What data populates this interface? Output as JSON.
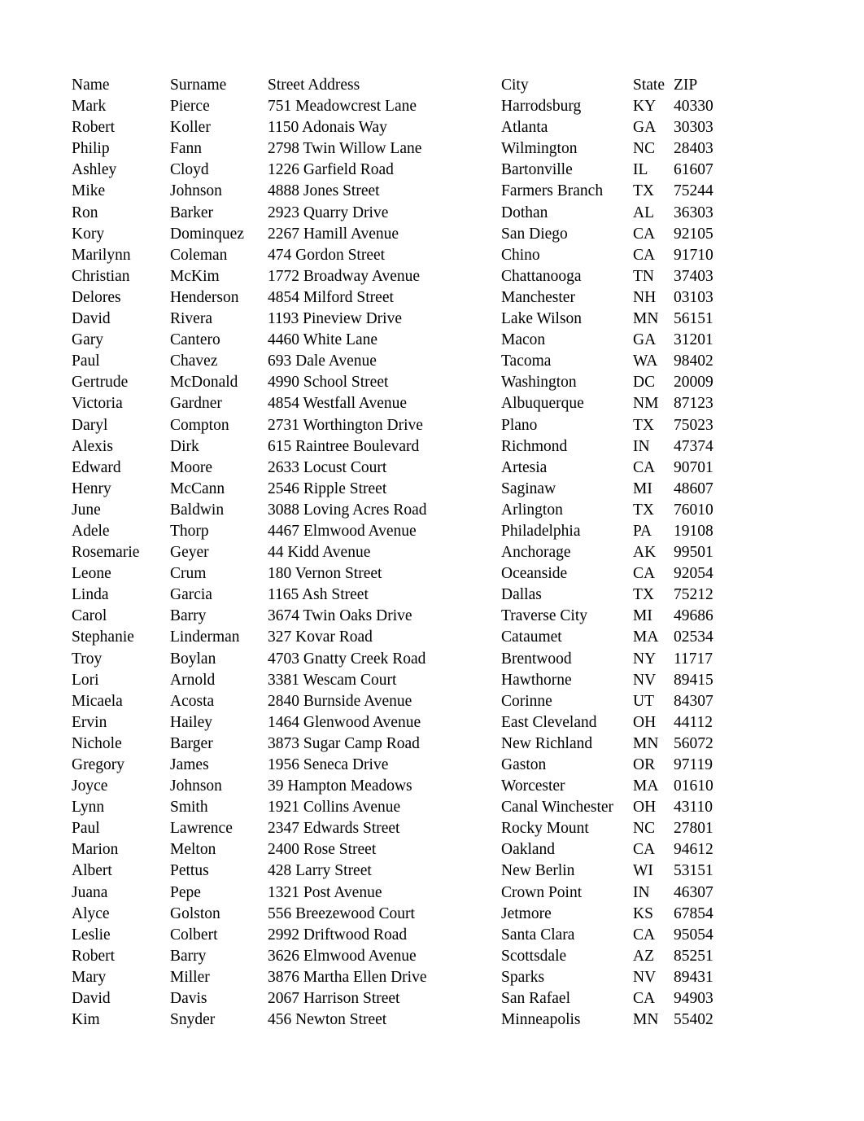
{
  "document": {
    "type": "address-list",
    "columns": [
      "Name",
      "Surname",
      "Street Address",
      "City",
      "State",
      "ZIP"
    ],
    "header": {
      "name": "Name",
      "surname": "Surname",
      "street": "Street Address",
      "city": "City",
      "state": "State",
      "zip": "ZIP"
    },
    "row_count": 44,
    "rows": [
      {
        "name": "Mark",
        "surname": "Pierce",
        "street": "751 Meadowcrest Lane",
        "city": "Harrodsburg",
        "state": "KY",
        "zip": "40330"
      },
      {
        "name": "Robert",
        "surname": "Koller",
        "street": "1150 Adonais Way",
        "city": "Atlanta",
        "state": "GA",
        "zip": "30303"
      },
      {
        "name": "Philip",
        "surname": "Fann",
        "street": "2798 Twin Willow Lane",
        "city": "Wilmington",
        "state": "NC",
        "zip": "28403"
      },
      {
        "name": "Ashley",
        "surname": "Cloyd",
        "street": "1226 Garfield Road",
        "city": "Bartonville",
        "state": "IL",
        "zip": "61607"
      },
      {
        "name": "Mike",
        "surname": "Johnson",
        "street": "4888 Jones Street",
        "city": "Farmers Branch",
        "state": "TX",
        "zip": "75244"
      },
      {
        "name": "Ron",
        "surname": "Barker",
        "street": "2923 Quarry Drive",
        "city": "Dothan",
        "state": "AL",
        "zip": "36303"
      },
      {
        "name": "Kory",
        "surname": "Dominquez",
        "street": "2267 Hamill Avenue",
        "city": "San Diego",
        "state": "CA",
        "zip": "92105"
      },
      {
        "name": "Marilynn",
        "surname": "Coleman",
        "street": "474 Gordon Street",
        "city": "Chino",
        "state": "CA",
        "zip": "91710"
      },
      {
        "name": "Christian",
        "surname": "McKim",
        "street": "1772 Broadway Avenue",
        "city": "Chattanooga",
        "state": "TN",
        "zip": "37403"
      },
      {
        "name": "Delores",
        "surname": "Henderson",
        "street": "4854 Milford Street",
        "city": "Manchester",
        "state": "NH",
        "zip": "03103"
      },
      {
        "name": "David",
        "surname": "Rivera",
        "street": "1193 Pineview Drive",
        "city": "Lake Wilson",
        "state": "MN",
        "zip": "56151"
      },
      {
        "name": "Gary",
        "surname": "Cantero",
        "street": "4460 White Lane",
        "city": "Macon",
        "state": "GA",
        "zip": "31201"
      },
      {
        "name": "Paul",
        "surname": "Chavez",
        "street": "693 Dale Avenue",
        "city": "Tacoma",
        "state": "WA",
        "zip": "98402"
      },
      {
        "name": "Gertrude",
        "surname": "McDonald",
        "street": "4990 School Street",
        "city": "Washington",
        "state": "DC",
        "zip": "20009"
      },
      {
        "name": "Victoria",
        "surname": "Gardner",
        "street": "4854 Westfall Avenue",
        "city": "Albuquerque",
        "state": "NM",
        "zip": "87123"
      },
      {
        "name": "Daryl",
        "surname": "Compton",
        "street": "2731 Worthington Drive",
        "city": "Plano",
        "state": "TX",
        "zip": "75023"
      },
      {
        "name": "Alexis",
        "surname": "Dirk",
        "street": "615 Raintree Boulevard",
        "city": "Richmond",
        "state": "IN",
        "zip": "47374"
      },
      {
        "name": "Edward",
        "surname": "Moore",
        "street": "2633 Locust Court",
        "city": "Artesia",
        "state": "CA",
        "zip": "90701"
      },
      {
        "name": "Henry",
        "surname": "McCann",
        "street": "2546 Ripple Street",
        "city": "Saginaw",
        "state": "MI",
        "zip": "48607"
      },
      {
        "name": "June",
        "surname": "Baldwin",
        "street": "3088 Loving Acres Road",
        "city": "Arlington",
        "state": "TX",
        "zip": "76010"
      },
      {
        "name": "Adele",
        "surname": "Thorp",
        "street": "4467 Elmwood Avenue",
        "city": "Philadelphia",
        "state": "PA",
        "zip": "19108"
      },
      {
        "name": "Rosemarie",
        "surname": "Geyer",
        "street": "44 Kidd Avenue",
        "city": "Anchorage",
        "state": "AK",
        "zip": "99501"
      },
      {
        "name": "Leone",
        "surname": "Crum",
        "street": "180 Vernon Street",
        "city": "Oceanside",
        "state": "CA",
        "zip": "92054"
      },
      {
        "name": "Linda",
        "surname": "Garcia",
        "street": "1165 Ash Street",
        "city": "Dallas",
        "state": "TX",
        "zip": "75212"
      },
      {
        "name": "Carol",
        "surname": "Barry",
        "street": "3674 Twin Oaks Drive",
        "city": "Traverse City",
        "state": "MI",
        "zip": "49686"
      },
      {
        "name": "Stephanie",
        "surname": "Linderman",
        "street": "327 Kovar Road",
        "city": "Cataumet",
        "state": "MA",
        "zip": "02534"
      },
      {
        "name": "Troy",
        "surname": "Boylan",
        "street": "4703 Gnatty Creek Road",
        "city": "Brentwood",
        "state": "NY",
        "zip": "11717"
      },
      {
        "name": "Lori",
        "surname": "Arnold",
        "street": "3381 Wescam Court",
        "city": "Hawthorne",
        "state": "NV",
        "zip": "89415"
      },
      {
        "name": "Micaela",
        "surname": "Acosta",
        "street": "2840 Burnside Avenue",
        "city": "Corinne",
        "state": "UT",
        "zip": "84307"
      },
      {
        "name": "Ervin",
        "surname": "Hailey",
        "street": "1464 Glenwood Avenue",
        "city": "East Cleveland",
        "state": "OH",
        "zip": "44112"
      },
      {
        "name": "Nichole",
        "surname": "Barger",
        "street": "3873 Sugar Camp Road",
        "city": "New Richland",
        "state": "MN",
        "zip": "56072"
      },
      {
        "name": "Gregory",
        "surname": "James",
        "street": "1956 Seneca Drive",
        "city": "Gaston",
        "state": "OR",
        "zip": "97119"
      },
      {
        "name": "Joyce",
        "surname": "Johnson",
        "street": "39 Hampton Meadows",
        "city": "Worcester",
        "state": "MA",
        "zip": "01610"
      },
      {
        "name": "Lynn",
        "surname": "Smith",
        "street": "1921 Collins Avenue",
        "city": "Canal Winchester",
        "state": "OH",
        "zip": "43110"
      },
      {
        "name": "Paul",
        "surname": "Lawrence",
        "street": "2347 Edwards Street",
        "city": "Rocky Mount",
        "state": "NC",
        "zip": "27801"
      },
      {
        "name": "Marion",
        "surname": "Melton",
        "street": "2400 Rose Street",
        "city": "Oakland",
        "state": "CA",
        "zip": "94612"
      },
      {
        "name": "Albert",
        "surname": "Pettus",
        "street": "428 Larry Street",
        "city": "New Berlin",
        "state": "WI",
        "zip": "53151"
      },
      {
        "name": "Juana",
        "surname": "Pepe",
        "street": "1321 Post Avenue",
        "city": "Crown Point",
        "state": "IN",
        "zip": "46307"
      },
      {
        "name": "Alyce",
        "surname": "Golston",
        "street": "556 Breezewood Court",
        "city": "Jetmore",
        "state": "KS",
        "zip": "67854"
      },
      {
        "name": "Leslie",
        "surname": "Colbert",
        "street": "2992 Driftwood Road",
        "city": "Santa Clara",
        "state": "CA",
        "zip": "95054"
      },
      {
        "name": "Robert",
        "surname": "Barry",
        "street": "3626 Elmwood Avenue",
        "city": "Scottsdale",
        "state": "AZ",
        "zip": "85251"
      },
      {
        "name": "Mary",
        "surname": "Miller",
        "street": "3876 Martha Ellen Drive",
        "city": "Sparks",
        "state": "NV",
        "zip": "89431"
      },
      {
        "name": "David",
        "surname": "Davis",
        "street": "2067 Harrison Street",
        "city": "San Rafael",
        "state": "CA",
        "zip": "94903"
      },
      {
        "name": "Kim",
        "surname": "Snyder",
        "street": "456 Newton Street",
        "city": "Minneapolis",
        "state": "MN",
        "zip": "55402"
      }
    ]
  },
  "style": {
    "text_color": "#000000",
    "background_color": "#ffffff"
  }
}
